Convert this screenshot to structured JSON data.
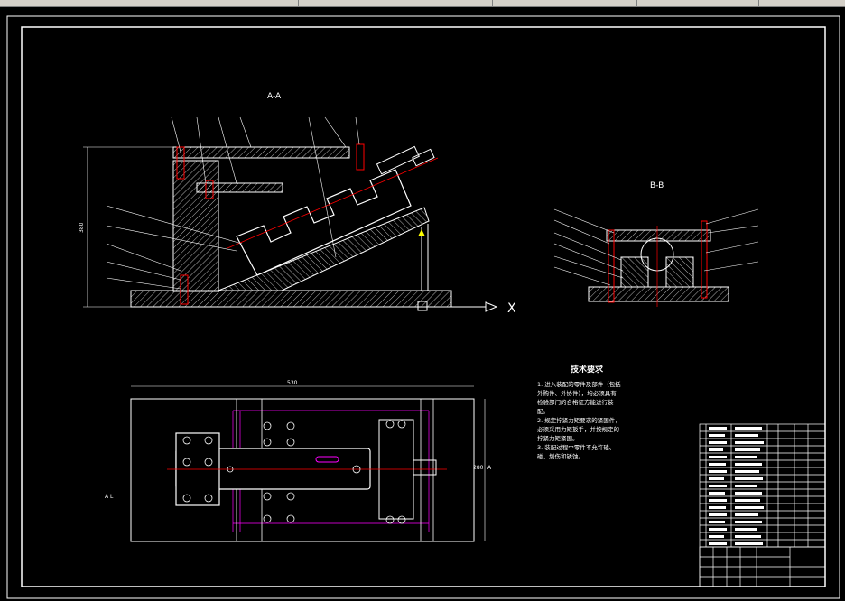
{
  "drawing": {
    "section_aa": {
      "label": "A-A",
      "dim_height": "380",
      "arrow_label": "X"
    },
    "section_bb": {
      "label": "B-B"
    },
    "plan_view": {
      "dim_width": "530",
      "dim_height": "280",
      "side_mark_left": "A L",
      "side_mark_right": "A"
    },
    "tech_requirements": {
      "title": "技术要求",
      "lines": [
        "1. 进入装配的零件及部件（包括",
        "外购件、外协件），均必须具有",
        "检验部门的合格证方能进行装",
        "配。",
        "2. 规定拧紧力矩要求的紧固件，",
        "必须采用力矩扳手，并按规定的",
        "拧紧力矩紧固。",
        "3. 装配过程中零件不允许磕、",
        "碰、划伤和锈蚀。"
      ]
    }
  },
  "colors": {
    "background": "#000000",
    "outline": "#ffffff",
    "centerline": "#ff0000",
    "hidden": "#ff00ff",
    "accent": "#ffff00"
  }
}
